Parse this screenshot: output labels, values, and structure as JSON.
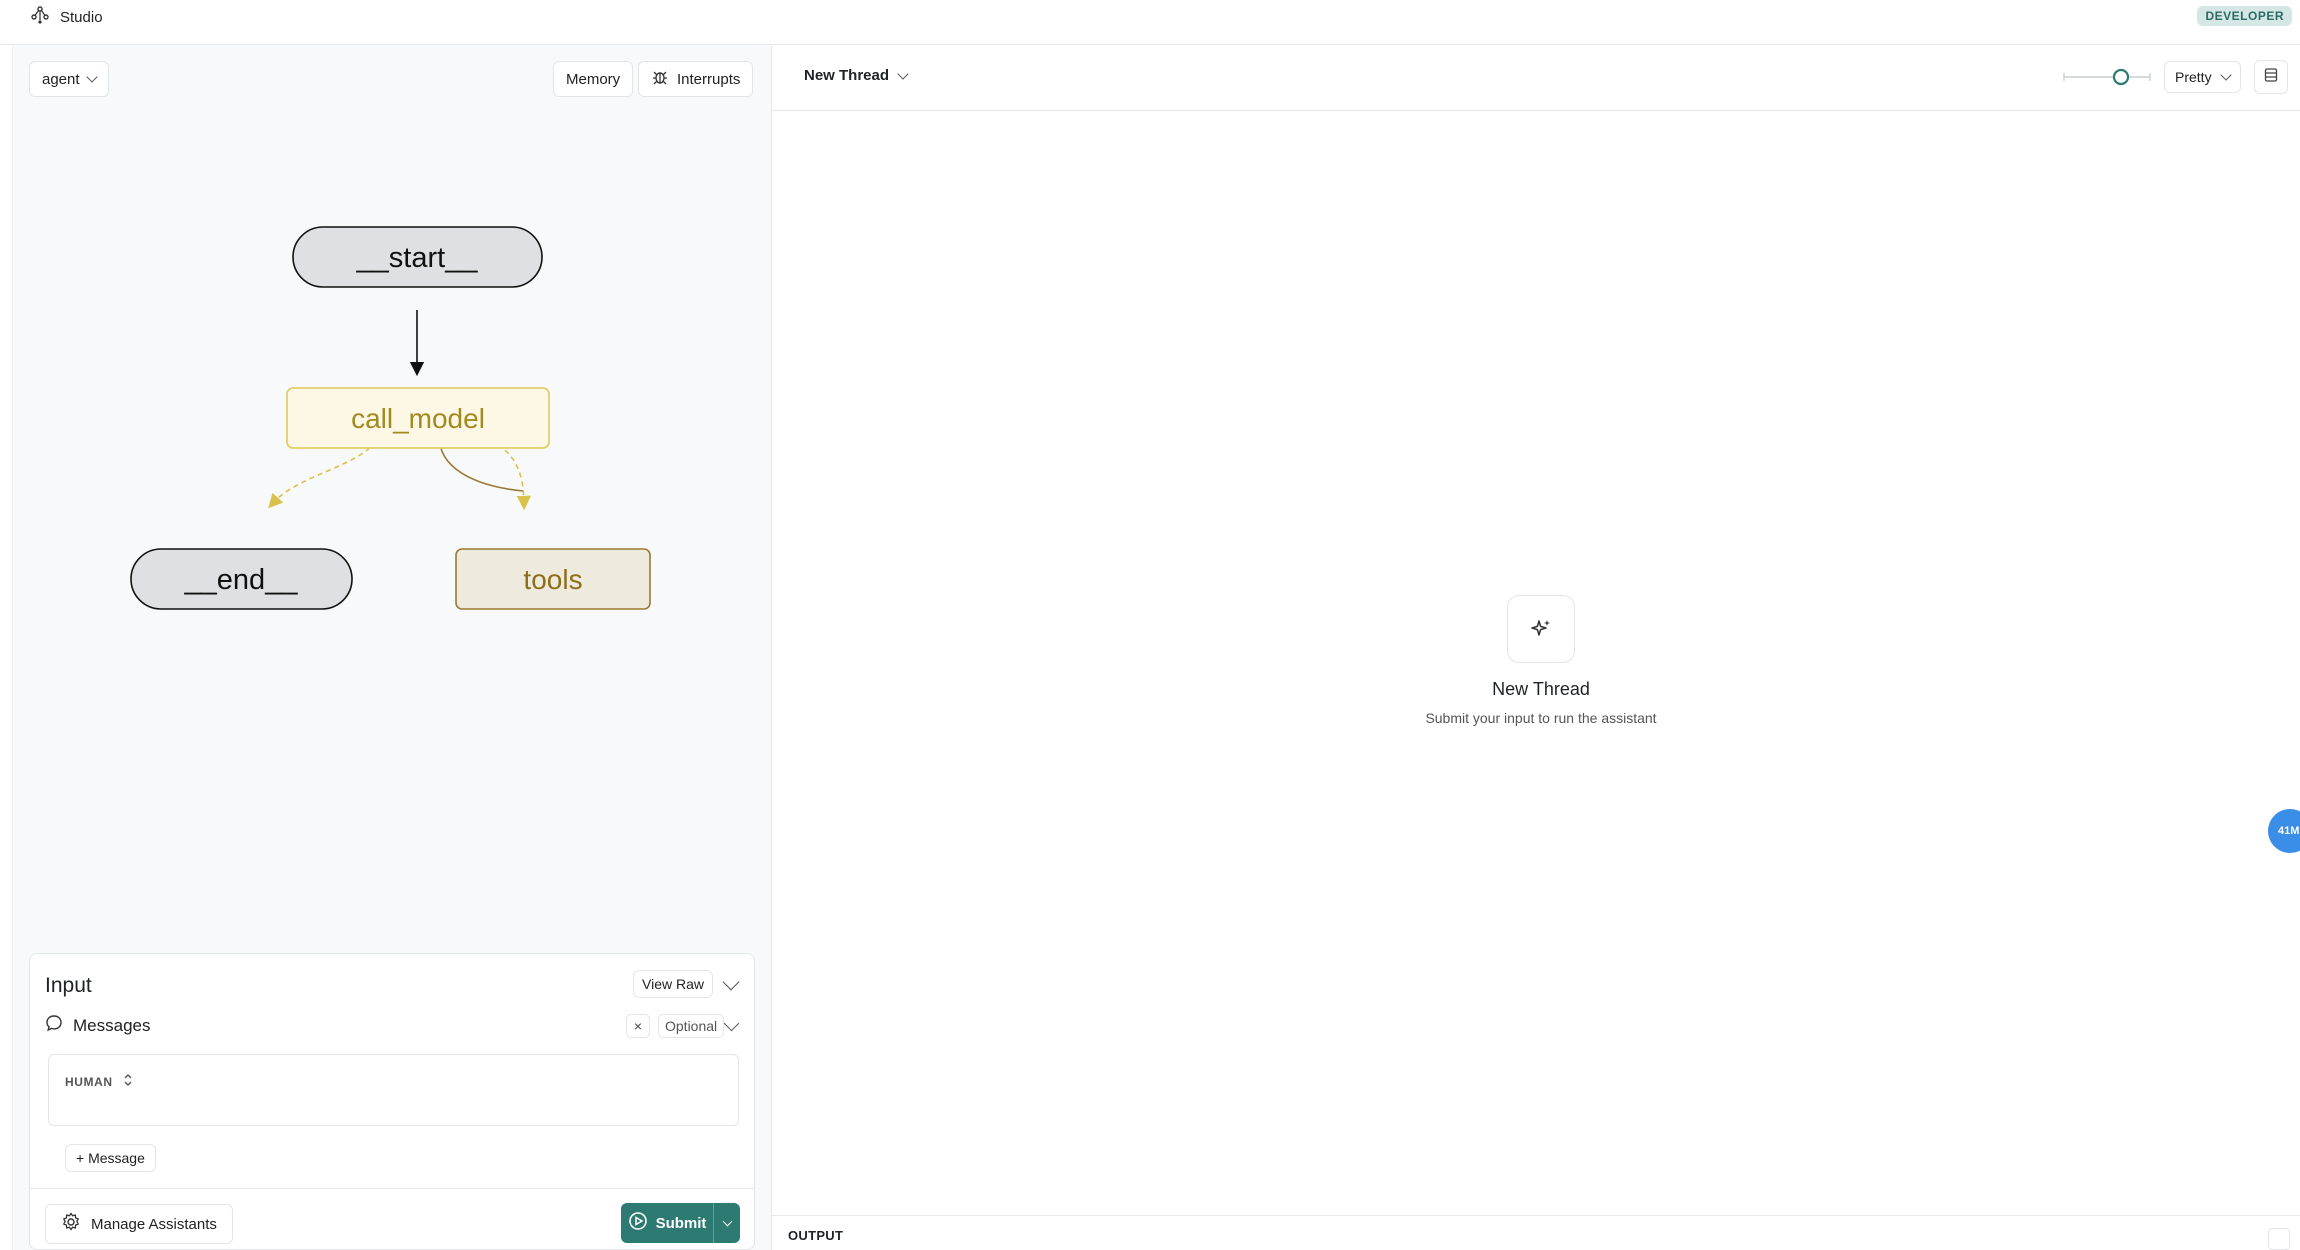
{
  "app": {
    "name": "Studio",
    "mode_badge": "DEVELOPER"
  },
  "left": {
    "agent_select": "agent",
    "memory_label": "Memory",
    "interrupts_label": "Interrupts",
    "graph": {
      "nodes": {
        "start": "__start__",
        "call_model": "call_model",
        "end": "__end__",
        "tools": "tools"
      }
    },
    "input": {
      "title": "Input",
      "view_raw": "View Raw",
      "messages_label": "Messages",
      "clear_label": "×",
      "optional_label": "Optional",
      "role": "HUMAN",
      "add_message": "+ Message",
      "manage_assistants": "Manage Assistants",
      "submit": "Submit"
    }
  },
  "right": {
    "thread_select": "New Thread",
    "view_mode": "Pretty",
    "empty_title": "New Thread",
    "empty_subtitle": "Submit your input to run the assistant",
    "side_badge": "41M",
    "output_label": "OUTPUT"
  },
  "colors": {
    "accent": "#2d7a72",
    "node_yellow": "#a28a1e",
    "node_tools": "#8d6e1a"
  }
}
